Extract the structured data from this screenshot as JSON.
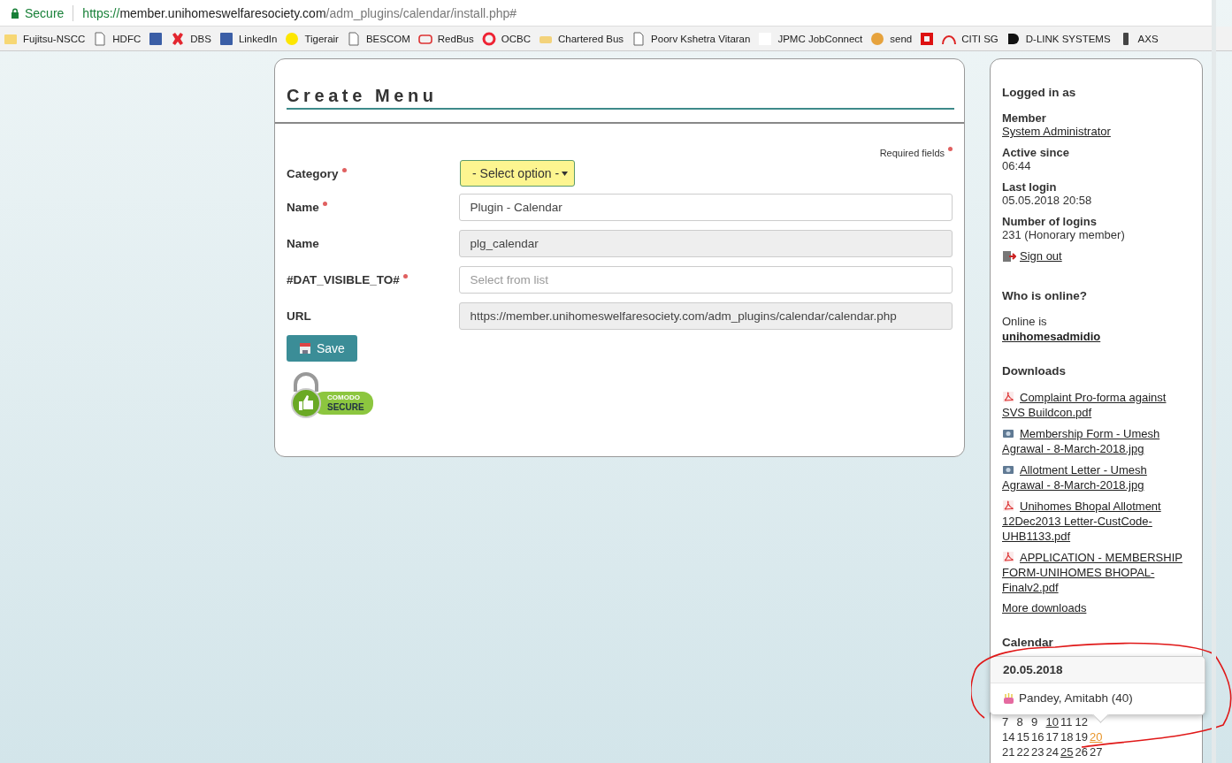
{
  "browser": {
    "secure_label": "Secure",
    "url_scheme": "https://",
    "url_host": "member.unihomeswelfaresociety.com",
    "url_path": "/adm_plugins/calendar/install.php#"
  },
  "bookmarks": [
    {
      "label": "Fujitsu-NSCC",
      "kind": "folder"
    },
    {
      "label": "HDFC",
      "kind": "page"
    },
    {
      "kind": "square-blue"
    },
    {
      "label": "DBS",
      "kind": "cross"
    },
    {
      "label": "LinkedIn",
      "kind": "square-blue"
    },
    {
      "label": "Tigerair",
      "kind": "dot-yellow"
    },
    {
      "label": "BESCOM",
      "kind": "page"
    },
    {
      "label": "RedBus",
      "kind": "bus"
    },
    {
      "label": "OCBC",
      "kind": "ring"
    },
    {
      "label": "Chartered Bus",
      "kind": "card"
    },
    {
      "label": "Poorv Kshetra Vitaran",
      "kind": "page"
    },
    {
      "label": "JPMC JobConnect",
      "kind": "blank"
    },
    {
      "label": "send",
      "kind": "badge"
    },
    {
      "kind": "square-red"
    },
    {
      "label": "CITI SG",
      "kind": "arc"
    },
    {
      "label": "D-LINK SYSTEMS",
      "kind": "block"
    },
    {
      "label": "AXS",
      "kind": "phone"
    }
  ],
  "form": {
    "title": "Create Menu",
    "required_note": "Required fields",
    "fields": [
      {
        "label": "Category",
        "required": true,
        "kind": "select",
        "value": "- Select option -"
      },
      {
        "label": "Name",
        "required": true,
        "kind": "input",
        "value": "Plugin - Calendar"
      },
      {
        "label": "Name",
        "required": false,
        "kind": "readonly",
        "value": "plg_calendar"
      },
      {
        "label": "#DAT_VISIBLE_TO#",
        "required": true,
        "kind": "input",
        "placeholder": "Select from list"
      },
      {
        "label": "URL",
        "required": false,
        "kind": "readonly",
        "value": "https://member.unihomeswelfaresociety.com/adm_plugins/calendar/calendar.php"
      }
    ],
    "save_button": "Save",
    "seal_top": "COMODO",
    "seal_bottom": "SECURE"
  },
  "sidebar": {
    "logged_in_title": "Logged in as",
    "login_items": [
      {
        "label": "Member",
        "value": "System Administrator",
        "link": true
      },
      {
        "label": "Active since",
        "value": "06:44",
        "link": false
      },
      {
        "label": "Last login",
        "value": "05.05.2018 20:58",
        "link": false
      },
      {
        "label": "Number of logins",
        "value": "231 (Honorary member)",
        "link": false
      }
    ],
    "sign_out": "Sign out",
    "online_title": "Who is online?",
    "online_text": "Online is",
    "online_user": "unihomesadmidio",
    "downloads_title": "Downloads",
    "downloads": [
      {
        "name": "Complaint Pro-forma against SVS Buildcon.pdf",
        "kind": "pdf"
      },
      {
        "name": "Membership Form - Umesh Agrawal - 8-March-2018.jpg",
        "kind": "image"
      },
      {
        "name": "Allotment Letter - Umesh Agrawal - 8-March-2018.jpg",
        "kind": "image"
      },
      {
        "name": "Unihomes Bhopal Allotment 12Dec2013 Letter-CustCode-UHB1133.pdf",
        "kind": "pdf"
      },
      {
        "name": "APPLICATION - MEMBERSHIP FORM-UNIHOMES BHOPAL-Finalv2.pdf",
        "kind": "pdf"
      }
    ],
    "more_downloads": "More downloads",
    "calendar_title": "Calendar",
    "popover": {
      "date": "20.05.2018",
      "entry": "Pandey, Amitabh (40)"
    },
    "weeks": [
      [
        {
          "d": "7",
          "kind": "plain"
        },
        {
          "d": "8",
          "kind": "plain"
        },
        {
          "d": "9",
          "kind": "plain"
        },
        {
          "d": "10",
          "kind": "event"
        },
        {
          "d": "11",
          "kind": "plain"
        },
        {
          "d": "12",
          "kind": "plain"
        }
      ],
      [
        {
          "d": "14",
          "kind": "plain"
        },
        {
          "d": "15",
          "kind": "plain"
        },
        {
          "d": "16",
          "kind": "plain"
        },
        {
          "d": "17",
          "kind": "plain"
        },
        {
          "d": "18",
          "kind": "plain"
        },
        {
          "d": "19",
          "kind": "plain"
        },
        {
          "d": "20",
          "kind": "birthday"
        }
      ],
      [
        {
          "d": "21",
          "kind": "plain"
        },
        {
          "d": "22",
          "kind": "plain"
        },
        {
          "d": "23",
          "kind": "plain"
        },
        {
          "d": "24",
          "kind": "plain"
        },
        {
          "d": "25",
          "kind": "event"
        },
        {
          "d": "26",
          "kind": "plain"
        },
        {
          "d": "27",
          "kind": "plain"
        }
      ]
    ]
  }
}
